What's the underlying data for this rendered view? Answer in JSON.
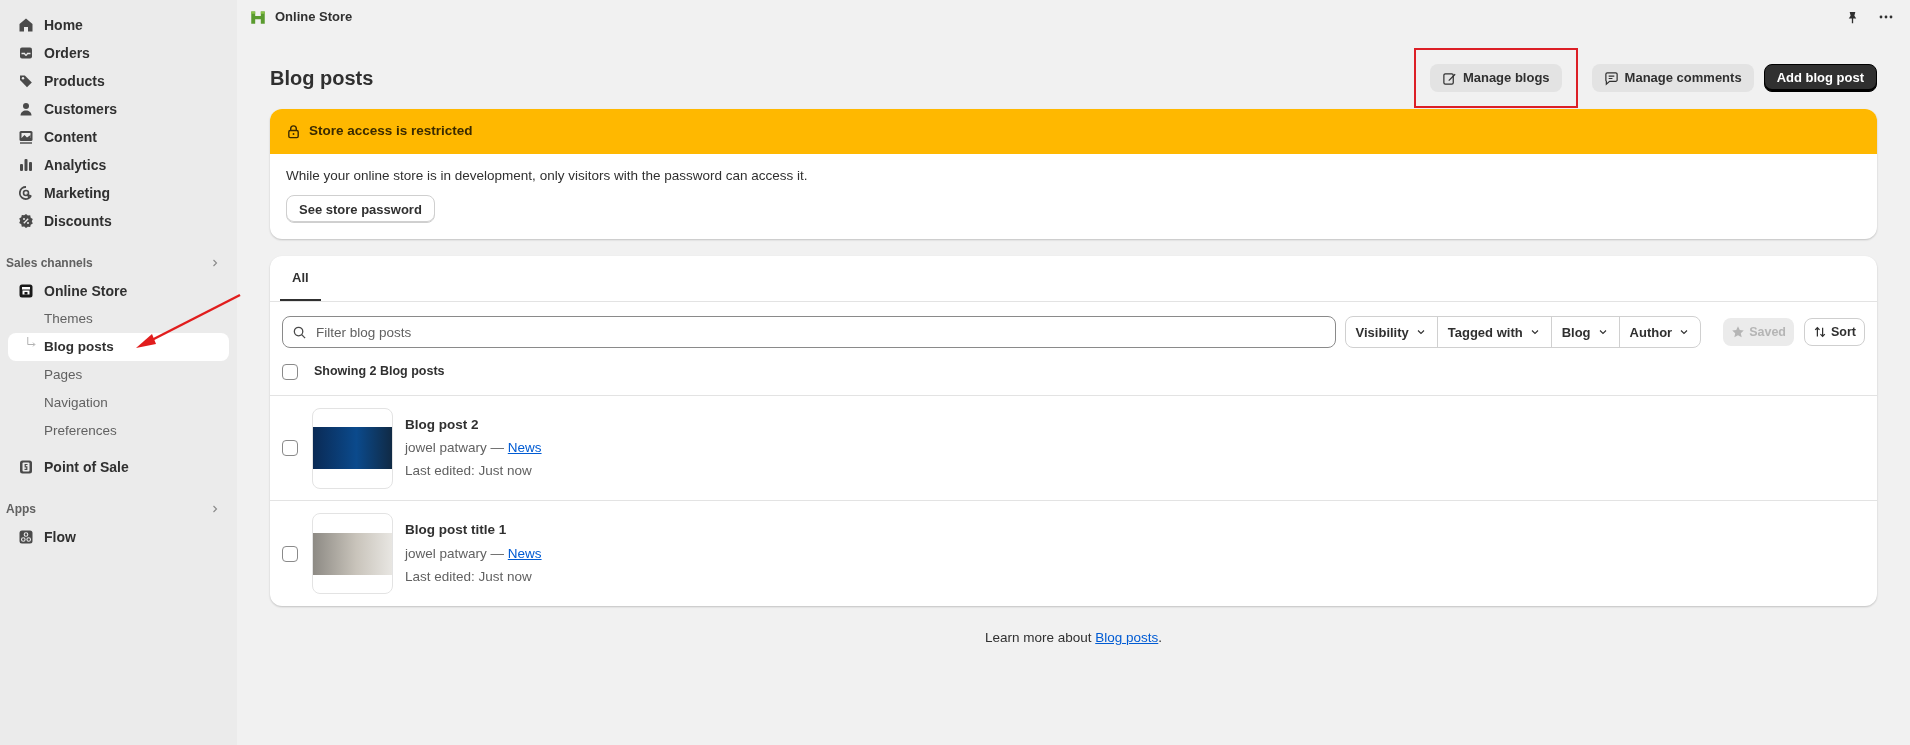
{
  "top_bar": {
    "title": "Online Store"
  },
  "sidebar": {
    "items": [
      {
        "label": "Home",
        "selected": false
      },
      {
        "label": "Orders",
        "selected": false
      },
      {
        "label": "Products",
        "selected": false
      },
      {
        "label": "Customers",
        "selected": false
      },
      {
        "label": "Content",
        "selected": false
      },
      {
        "label": "Analytics",
        "selected": false
      },
      {
        "label": "Marketing",
        "selected": false
      },
      {
        "label": "Discounts",
        "selected": false
      }
    ],
    "sections": [
      {
        "label": "Sales channels",
        "items": [
          {
            "label": "Online Store",
            "selected": false,
            "children": [
              {
                "label": "Themes",
                "selected": false
              },
              {
                "label": "Blog posts",
                "selected": true
              },
              {
                "label": "Pages",
                "selected": false
              },
              {
                "label": "Navigation",
                "selected": false
              },
              {
                "label": "Preferences",
                "selected": false
              }
            ]
          },
          {
            "label": "Point of Sale",
            "selected": false
          }
        ]
      },
      {
        "label": "Apps",
        "items": [
          {
            "label": "Flow",
            "selected": false
          }
        ]
      }
    ]
  },
  "page": {
    "title": "Blog posts",
    "actions": [
      {
        "label": "Manage blogs",
        "kind": "secondary",
        "highlighted": true
      },
      {
        "label": "Manage comments",
        "kind": "secondary",
        "highlighted": false
      },
      {
        "label": "Add blog post",
        "kind": "primary",
        "highlighted": false
      }
    ],
    "banner": {
      "title": "Store access is restricted",
      "message": "While your online store is in development, only visitors with the password can access it.",
      "button": "See store password"
    },
    "tabs": [
      {
        "label": "All",
        "selected": true
      }
    ],
    "search": {
      "placeholder": "Filter blog posts"
    },
    "filters": [
      "Visibility",
      "Tagged with",
      "Blog",
      "Author"
    ],
    "saved": {
      "label": "Saved",
      "disabled": true
    },
    "sort": "Sort",
    "select_all": {
      "label": "Showing 2 Blog posts",
      "checked": false
    },
    "posts": [
      {
        "title": "Blog post 2",
        "author": "jowel patwary —",
        "blog": "News",
        "edited": "Last edited: Just now",
        "checked": false
      },
      {
        "title": "Blog post title 1",
        "author": "jowel patwary —",
        "blog": "News",
        "edited": "Last edited: Just now",
        "checked": false
      }
    ],
    "footer": {
      "text": "Learn more about",
      "link": "Blog posts",
      "end": "."
    }
  }
}
